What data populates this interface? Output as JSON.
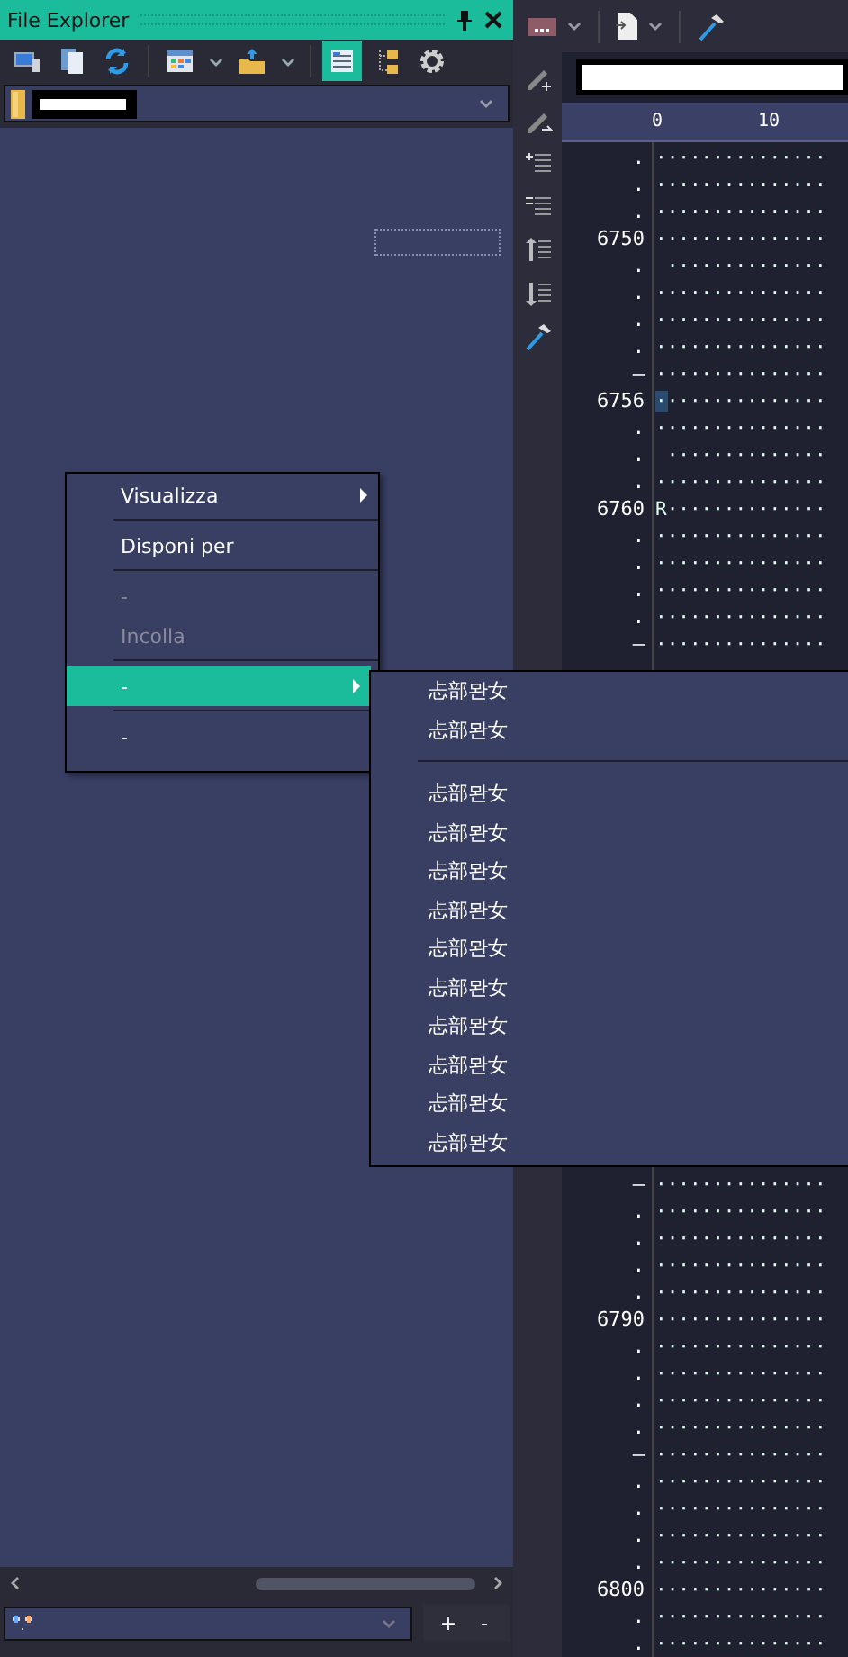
{
  "explorer": {
    "title": "File Explorer",
    "toolbar": [
      [
        {
          "kind": "computer",
          "selected": false
        },
        {
          "kind": "pages",
          "selected": false
        },
        {
          "kind": "refresh",
          "selected": false
        }
      ],
      [
        {
          "kind": "grid",
          "selected": false
        },
        {
          "kind": "caret",
          "selected": false
        },
        {
          "kind": "folder-up",
          "selected": false
        },
        {
          "kind": "caret",
          "selected": false
        }
      ],
      [
        {
          "kind": "list",
          "selected": true
        },
        {
          "kind": "tree",
          "selected": false
        },
        {
          "kind": "gear",
          "selected": false
        }
      ]
    ],
    "bottom_buttons": [
      "+",
      "-"
    ]
  },
  "context_menu": [
    {
      "kind": "item",
      "label": "Visualizza",
      "submenu": true,
      "disabled": false,
      "selected": false
    },
    {
      "kind": "separator"
    },
    {
      "kind": "item",
      "label": "Disponi per",
      "submenu": false,
      "disabled": false,
      "selected": false
    },
    {
      "kind": "separator"
    },
    {
      "kind": "item",
      "label": "-",
      "submenu": false,
      "disabled": true,
      "selected": false
    },
    {
      "kind": "item",
      "label": "Incolla",
      "submenu": false,
      "disabled": true,
      "selected": false
    },
    {
      "kind": "separator"
    },
    {
      "kind": "item",
      "label": "-",
      "submenu": true,
      "disabled": false,
      "selected": true
    },
    {
      "kind": "separator"
    },
    {
      "kind": "item",
      "label": "-",
      "submenu": false,
      "disabled": false,
      "selected": false
    }
  ],
  "submenu": [
    {
      "kind": "item",
      "label": "忐部뫈女"
    },
    {
      "kind": "item",
      "label": "忐部뫈女"
    },
    {
      "kind": "separator"
    },
    {
      "kind": "item",
      "label": "忐部뫈女"
    },
    {
      "kind": "item",
      "label": "忐部뫈女"
    },
    {
      "kind": "item",
      "label": "忐部뫈女"
    },
    {
      "kind": "item",
      "label": "忐部뫈女"
    },
    {
      "kind": "item",
      "label": "忐部뫈女"
    },
    {
      "kind": "item",
      "label": "忐部뫈女"
    },
    {
      "kind": "item",
      "label": "忐部뫈女"
    },
    {
      "kind": "item",
      "label": "忐部뫈女"
    },
    {
      "kind": "item",
      "label": "忐部뫈女"
    },
    {
      "kind": "item",
      "label": "忐部뫈女"
    }
  ],
  "editor": {
    "ruler": [
      "0",
      "10"
    ],
    "rows_top": [
      {
        "line": ".",
        "text": "···············",
        "cursor": false
      },
      {
        "line": ".",
        "text": "···············",
        "cursor": false
      },
      {
        "line": ".",
        "text": "···············",
        "cursor": false
      },
      {
        "line": "6750",
        "text": "···············",
        "cursor": false
      },
      {
        "line": ".",
        "text": " ··············",
        "cursor": false
      },
      {
        "line": ".",
        "text": "···············",
        "cursor": false
      },
      {
        "line": ".",
        "text": "···············",
        "cursor": false
      },
      {
        "line": ".",
        "text": "···············",
        "cursor": false
      },
      {
        "line": "–",
        "text": "···············",
        "cursor": false
      },
      {
        "line": "6756",
        "text": "···············",
        "cursor": true
      },
      {
        "line": ".",
        "text": "···············",
        "cursor": false
      },
      {
        "line": ".",
        "text": " ··············",
        "cursor": false
      },
      {
        "line": ".",
        "text": "···············",
        "cursor": false
      },
      {
        "line": "6760",
        "text": "R··············",
        "cursor": false
      },
      {
        "line": ".",
        "text": "···············",
        "cursor": false
      },
      {
        "line": ".",
        "text": "···············",
        "cursor": false
      },
      {
        "line": ".",
        "text": "···············",
        "cursor": false
      },
      {
        "line": ".",
        "text": "···············",
        "cursor": false
      },
      {
        "line": "–",
        "text": "···············",
        "cursor": false
      }
    ],
    "rows_bottom": [
      {
        "line": "–",
        "text": "···············",
        "cursor": false
      },
      {
        "line": ".",
        "text": "···············",
        "cursor": false
      },
      {
        "line": ".",
        "text": "···············",
        "cursor": false
      },
      {
        "line": ".",
        "text": "···············",
        "cursor": false
      },
      {
        "line": ".",
        "text": "···············",
        "cursor": false
      },
      {
        "line": "6790",
        "text": "···············",
        "cursor": false
      },
      {
        "line": ".",
        "text": "···············",
        "cursor": false
      },
      {
        "line": ".",
        "text": "···············",
        "cursor": false
      },
      {
        "line": ".",
        "text": "···············",
        "cursor": false
      },
      {
        "line": ".",
        "text": "···············",
        "cursor": false
      },
      {
        "line": "–",
        "text": "···············",
        "cursor": false
      },
      {
        "line": ".",
        "text": "···············",
        "cursor": false
      },
      {
        "line": ".",
        "text": "···············",
        "cursor": false
      },
      {
        "line": ".",
        "text": "···············",
        "cursor": false
      },
      {
        "line": ".",
        "text": "···············",
        "cursor": false
      },
      {
        "line": "6800",
        "text": "···············",
        "cursor": false
      },
      {
        "line": ".",
        "text": "···············",
        "cursor": false
      },
      {
        "line": ".",
        "text": "···············",
        "cursor": false
      }
    ]
  }
}
